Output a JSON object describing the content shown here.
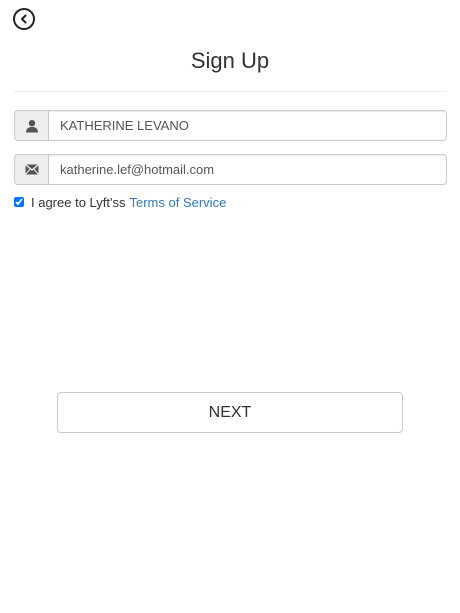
{
  "header": {
    "title": "Sign Up",
    "back_icon": "chevron-left-circle-icon"
  },
  "form": {
    "name": {
      "icon": "user-icon",
      "value": "KATHERINE LEVANO"
    },
    "email": {
      "icon": "envelope-icon",
      "value": "katherine.lef@hotmail.com"
    },
    "agree": {
      "checked": true,
      "text": "I agree to Lyft'ss",
      "link_text": "Terms of Service"
    },
    "next_label": "NEXT"
  },
  "colors": {
    "link": "#337ab7",
    "addon_bg": "#eeeeee",
    "border": "#cccccc"
  }
}
